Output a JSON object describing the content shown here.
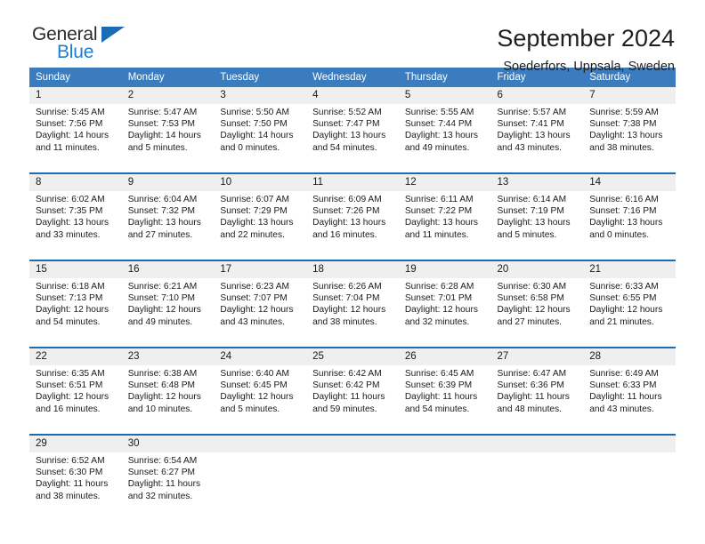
{
  "brand": {
    "name_part1": "General",
    "name_part2": "Blue",
    "triangle_color": "#1b6cb5",
    "blue_color": "#1b7ed0"
  },
  "header": {
    "title": "September 2024",
    "subtitle": "Soederfors, Uppsala, Sweden"
  },
  "theme": {
    "header_blue": "#3b7cbe",
    "separator_blue": "#1b6cb5",
    "daynum_band": "#efefef"
  },
  "weekday_headers": [
    "Sunday",
    "Monday",
    "Tuesday",
    "Wednesday",
    "Thursday",
    "Friday",
    "Saturday"
  ],
  "weeks": [
    {
      "days": [
        {
          "date": "1",
          "sunrise": "Sunrise: 5:45 AM",
          "sunset": "Sunset: 7:56 PM",
          "daylight_l1": "Daylight: 14 hours",
          "daylight_l2": "and 11 minutes."
        },
        {
          "date": "2",
          "sunrise": "Sunrise: 5:47 AM",
          "sunset": "Sunset: 7:53 PM",
          "daylight_l1": "Daylight: 14 hours",
          "daylight_l2": "and 5 minutes."
        },
        {
          "date": "3",
          "sunrise": "Sunrise: 5:50 AM",
          "sunset": "Sunset: 7:50 PM",
          "daylight_l1": "Daylight: 14 hours",
          "daylight_l2": "and 0 minutes."
        },
        {
          "date": "4",
          "sunrise": "Sunrise: 5:52 AM",
          "sunset": "Sunset: 7:47 PM",
          "daylight_l1": "Daylight: 13 hours",
          "daylight_l2": "and 54 minutes."
        },
        {
          "date": "5",
          "sunrise": "Sunrise: 5:55 AM",
          "sunset": "Sunset: 7:44 PM",
          "daylight_l1": "Daylight: 13 hours",
          "daylight_l2": "and 49 minutes."
        },
        {
          "date": "6",
          "sunrise": "Sunrise: 5:57 AM",
          "sunset": "Sunset: 7:41 PM",
          "daylight_l1": "Daylight: 13 hours",
          "daylight_l2": "and 43 minutes."
        },
        {
          "date": "7",
          "sunrise": "Sunrise: 5:59 AM",
          "sunset": "Sunset: 7:38 PM",
          "daylight_l1": "Daylight: 13 hours",
          "daylight_l2": "and 38 minutes."
        }
      ]
    },
    {
      "days": [
        {
          "date": "8",
          "sunrise": "Sunrise: 6:02 AM",
          "sunset": "Sunset: 7:35 PM",
          "daylight_l1": "Daylight: 13 hours",
          "daylight_l2": "and 33 minutes."
        },
        {
          "date": "9",
          "sunrise": "Sunrise: 6:04 AM",
          "sunset": "Sunset: 7:32 PM",
          "daylight_l1": "Daylight: 13 hours",
          "daylight_l2": "and 27 minutes."
        },
        {
          "date": "10",
          "sunrise": "Sunrise: 6:07 AM",
          "sunset": "Sunset: 7:29 PM",
          "daylight_l1": "Daylight: 13 hours",
          "daylight_l2": "and 22 minutes."
        },
        {
          "date": "11",
          "sunrise": "Sunrise: 6:09 AM",
          "sunset": "Sunset: 7:26 PM",
          "daylight_l1": "Daylight: 13 hours",
          "daylight_l2": "and 16 minutes."
        },
        {
          "date": "12",
          "sunrise": "Sunrise: 6:11 AM",
          "sunset": "Sunset: 7:22 PM",
          "daylight_l1": "Daylight: 13 hours",
          "daylight_l2": "and 11 minutes."
        },
        {
          "date": "13",
          "sunrise": "Sunrise: 6:14 AM",
          "sunset": "Sunset: 7:19 PM",
          "daylight_l1": "Daylight: 13 hours",
          "daylight_l2": "and 5 minutes."
        },
        {
          "date": "14",
          "sunrise": "Sunrise: 6:16 AM",
          "sunset": "Sunset: 7:16 PM",
          "daylight_l1": "Daylight: 13 hours",
          "daylight_l2": "and 0 minutes."
        }
      ]
    },
    {
      "days": [
        {
          "date": "15",
          "sunrise": "Sunrise: 6:18 AM",
          "sunset": "Sunset: 7:13 PM",
          "daylight_l1": "Daylight: 12 hours",
          "daylight_l2": "and 54 minutes."
        },
        {
          "date": "16",
          "sunrise": "Sunrise: 6:21 AM",
          "sunset": "Sunset: 7:10 PM",
          "daylight_l1": "Daylight: 12 hours",
          "daylight_l2": "and 49 minutes."
        },
        {
          "date": "17",
          "sunrise": "Sunrise: 6:23 AM",
          "sunset": "Sunset: 7:07 PM",
          "daylight_l1": "Daylight: 12 hours",
          "daylight_l2": "and 43 minutes."
        },
        {
          "date": "18",
          "sunrise": "Sunrise: 6:26 AM",
          "sunset": "Sunset: 7:04 PM",
          "daylight_l1": "Daylight: 12 hours",
          "daylight_l2": "and 38 minutes."
        },
        {
          "date": "19",
          "sunrise": "Sunrise: 6:28 AM",
          "sunset": "Sunset: 7:01 PM",
          "daylight_l1": "Daylight: 12 hours",
          "daylight_l2": "and 32 minutes."
        },
        {
          "date": "20",
          "sunrise": "Sunrise: 6:30 AM",
          "sunset": "Sunset: 6:58 PM",
          "daylight_l1": "Daylight: 12 hours",
          "daylight_l2": "and 27 minutes."
        },
        {
          "date": "21",
          "sunrise": "Sunrise: 6:33 AM",
          "sunset": "Sunset: 6:55 PM",
          "daylight_l1": "Daylight: 12 hours",
          "daylight_l2": "and 21 minutes."
        }
      ]
    },
    {
      "days": [
        {
          "date": "22",
          "sunrise": "Sunrise: 6:35 AM",
          "sunset": "Sunset: 6:51 PM",
          "daylight_l1": "Daylight: 12 hours",
          "daylight_l2": "and 16 minutes."
        },
        {
          "date": "23",
          "sunrise": "Sunrise: 6:38 AM",
          "sunset": "Sunset: 6:48 PM",
          "daylight_l1": "Daylight: 12 hours",
          "daylight_l2": "and 10 minutes."
        },
        {
          "date": "24",
          "sunrise": "Sunrise: 6:40 AM",
          "sunset": "Sunset: 6:45 PM",
          "daylight_l1": "Daylight: 12 hours",
          "daylight_l2": "and 5 minutes."
        },
        {
          "date": "25",
          "sunrise": "Sunrise: 6:42 AM",
          "sunset": "Sunset: 6:42 PM",
          "daylight_l1": "Daylight: 11 hours",
          "daylight_l2": "and 59 minutes."
        },
        {
          "date": "26",
          "sunrise": "Sunrise: 6:45 AM",
          "sunset": "Sunset: 6:39 PM",
          "daylight_l1": "Daylight: 11 hours",
          "daylight_l2": "and 54 minutes."
        },
        {
          "date": "27",
          "sunrise": "Sunrise: 6:47 AM",
          "sunset": "Sunset: 6:36 PM",
          "daylight_l1": "Daylight: 11 hours",
          "daylight_l2": "and 48 minutes."
        },
        {
          "date": "28",
          "sunrise": "Sunrise: 6:49 AM",
          "sunset": "Sunset: 6:33 PM",
          "daylight_l1": "Daylight: 11 hours",
          "daylight_l2": "and 43 minutes."
        }
      ]
    },
    {
      "days": [
        {
          "date": "29",
          "sunrise": "Sunrise: 6:52 AM",
          "sunset": "Sunset: 6:30 PM",
          "daylight_l1": "Daylight: 11 hours",
          "daylight_l2": "and 38 minutes."
        },
        {
          "date": "30",
          "sunrise": "Sunrise: 6:54 AM",
          "sunset": "Sunset: 6:27 PM",
          "daylight_l1": "Daylight: 11 hours",
          "daylight_l2": "and 32 minutes."
        },
        {
          "date": "",
          "sunrise": "",
          "sunset": "",
          "daylight_l1": "",
          "daylight_l2": ""
        },
        {
          "date": "",
          "sunrise": "",
          "sunset": "",
          "daylight_l1": "",
          "daylight_l2": ""
        },
        {
          "date": "",
          "sunrise": "",
          "sunset": "",
          "daylight_l1": "",
          "daylight_l2": ""
        },
        {
          "date": "",
          "sunrise": "",
          "sunset": "",
          "daylight_l1": "",
          "daylight_l2": ""
        },
        {
          "date": "",
          "sunrise": "",
          "sunset": "",
          "daylight_l1": "",
          "daylight_l2": ""
        }
      ]
    }
  ]
}
